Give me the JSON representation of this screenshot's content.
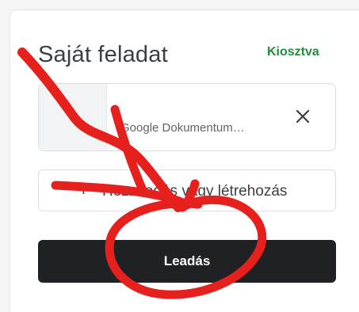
{
  "panel": {
    "title": "Saját feladat",
    "status": "Kiosztva"
  },
  "attachment": {
    "title": "",
    "type_label": "Google Dokumentum…",
    "remove_icon": "close-icon"
  },
  "add_button": {
    "icon": "plus-icon",
    "label": "Hozzáadás vagy létrehozás"
  },
  "submit_button": {
    "label": "Leadás"
  },
  "colors": {
    "status_green": "#1e8e3e",
    "button_dark": "#202124",
    "annotation_red": "#e6201d"
  }
}
